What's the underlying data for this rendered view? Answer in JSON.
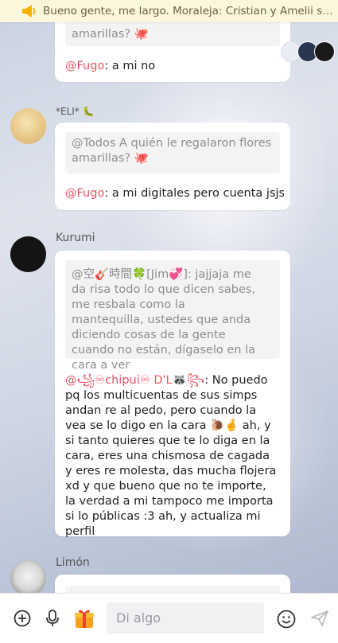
{
  "pinned": {
    "text": "Bueno gente, me largo. Moraleja: Cristian y Amelii son ca...",
    "icon": "megaphone-icon"
  },
  "messages": [
    {
      "quote_tail": "amarillas? 🐙",
      "reply_mention": "@Fugo",
      "reply_text": ": a mi no"
    },
    {
      "author": "*ELI* 🐛",
      "quote": "@Todos A quién le regalaron flores amarillas? 🐙",
      "reply_mention": "@Fugo",
      "reply_text": ": a mi digitales pero cuenta jsjs"
    },
    {
      "author": "Kurumi",
      "quote": "@空🎸時間🍀[Jim💞]: jajjaja me da risa todo lo que dicen sabes, me resbala como la mantequilla, ustedes que anda diciendo cosas de la gente cuando no están, dígaselo en la cara a ver",
      "reply_mention": "@꧁♾chipui♾ D'L🦝꧂",
      "reply_text": ": No puedo pq los multicuentas de sus simps andan re al pedo, pero cuando la vea se lo digo en la cara 🐌🤞 ah, y si tanto quieres que te lo diga en la cara, eres una chismosa de cagada y eres re molesta, das mucha flojera xd y que bueno que no te importe,  la verdad a mi tampoco me importa si lo públicas :3 ah, y actualiza mi perfil"
    },
    {
      "author": "Limón"
    }
  ],
  "composer": {
    "placeholder": "Di algo",
    "icons": [
      "add-icon",
      "microphone-icon",
      "gift-icon",
      "emoji-icon",
      "send-icon"
    ]
  },
  "colors": {
    "mention": "#ef4f63",
    "pinned_bg": "#fbf6dc",
    "quote_bg": "#f3f3f4"
  }
}
